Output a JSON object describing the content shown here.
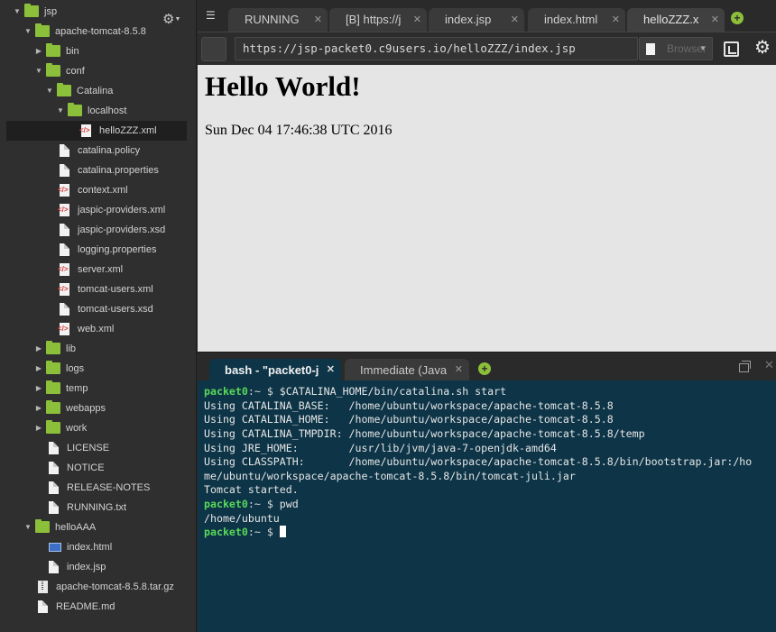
{
  "sidebar": {
    "tree": [
      {
        "label": "jsp",
        "type": "folder",
        "depth": 0,
        "expanded": true
      },
      {
        "label": "apache-tomcat-8.5.8",
        "type": "folder",
        "depth": 1,
        "expanded": true
      },
      {
        "label": "bin",
        "type": "folder",
        "depth": 2,
        "expanded": false
      },
      {
        "label": "conf",
        "type": "folder",
        "depth": 2,
        "expanded": true
      },
      {
        "label": "Catalina",
        "type": "folder",
        "depth": 3,
        "expanded": true
      },
      {
        "label": "localhost",
        "type": "folder",
        "depth": 4,
        "expanded": true
      },
      {
        "label": "helloZZZ.xml",
        "type": "xml",
        "depth": 5,
        "selected": true
      },
      {
        "label": "catalina.policy",
        "type": "file",
        "depth": 3
      },
      {
        "label": "catalina.properties",
        "type": "file",
        "depth": 3
      },
      {
        "label": "context.xml",
        "type": "xml",
        "depth": 3
      },
      {
        "label": "jaspic-providers.xml",
        "type": "xml",
        "depth": 3
      },
      {
        "label": "jaspic-providers.xsd",
        "type": "file",
        "depth": 3
      },
      {
        "label": "logging.properties",
        "type": "file",
        "depth": 3
      },
      {
        "label": "server.xml",
        "type": "xml",
        "depth": 3
      },
      {
        "label": "tomcat-users.xml",
        "type": "xml",
        "depth": 3
      },
      {
        "label": "tomcat-users.xsd",
        "type": "file",
        "depth": 3
      },
      {
        "label": "web.xml",
        "type": "xml",
        "depth": 3
      },
      {
        "label": "lib",
        "type": "folder",
        "depth": 2,
        "expanded": false
      },
      {
        "label": "logs",
        "type": "folder",
        "depth": 2,
        "expanded": false
      },
      {
        "label": "temp",
        "type": "folder",
        "depth": 2,
        "expanded": false
      },
      {
        "label": "webapps",
        "type": "folder",
        "depth": 2,
        "expanded": false
      },
      {
        "label": "work",
        "type": "folder",
        "depth": 2,
        "expanded": false
      },
      {
        "label": "LICENSE",
        "type": "file",
        "depth": 2
      },
      {
        "label": "NOTICE",
        "type": "file",
        "depth": 2
      },
      {
        "label": "RELEASE-NOTES",
        "type": "file",
        "depth": 2
      },
      {
        "label": "RUNNING.txt",
        "type": "file",
        "depth": 2
      },
      {
        "label": "helloAAA",
        "type": "folder",
        "depth": 1,
        "expanded": true
      },
      {
        "label": "index.html",
        "type": "html",
        "depth": 2
      },
      {
        "label": "index.jsp",
        "type": "file",
        "depth": 2
      },
      {
        "label": "apache-tomcat-8.5.8.tar.gz",
        "type": "archive",
        "depth": 1
      },
      {
        "label": "README.md",
        "type": "file",
        "depth": 1
      }
    ]
  },
  "tabs": [
    {
      "label": "RUNNING",
      "closable": true
    },
    {
      "label": "[B] https://j",
      "closable": true
    },
    {
      "label": "index.jsp",
      "closable": true
    },
    {
      "label": "index.html",
      "closable": true
    },
    {
      "label": "helloZZZ.x",
      "closable": true,
      "active": true
    }
  ],
  "urlbar": {
    "url": "https://jsp-packet0.c9users.io/helloZZZ/index.jsp",
    "browser_label": "Browser"
  },
  "preview": {
    "heading": "Hello World!",
    "date": "Sun Dec 04 17:46:38 UTC 2016"
  },
  "terminal": {
    "tabs": [
      {
        "label": "bash - \"packet0-j"
      },
      {
        "label": "Immediate (Java"
      }
    ],
    "prompt_user": "packet0",
    "prompt_path": ":~ $ ",
    "lines": [
      {
        "prompt": true,
        "text": "$CATALINA_HOME/bin/catalina.sh start"
      },
      {
        "text": "Using CATALINA_BASE:   /home/ubuntu/workspace/apache-tomcat-8.5.8"
      },
      {
        "text": "Using CATALINA_HOME:   /home/ubuntu/workspace/apache-tomcat-8.5.8"
      },
      {
        "text": "Using CATALINA_TMPDIR: /home/ubuntu/workspace/apache-tomcat-8.5.8/temp"
      },
      {
        "text": "Using JRE_HOME:        /usr/lib/jvm/java-7-openjdk-amd64"
      },
      {
        "text": "Using CLASSPATH:       /home/ubuntu/workspace/apache-tomcat-8.5.8/bin/bootstrap.jar:/ho"
      },
      {
        "text": "me/ubuntu/workspace/apache-tomcat-8.5.8/bin/tomcat-juli.jar"
      },
      {
        "text": "Tomcat started."
      },
      {
        "prompt": true,
        "text": "pwd"
      },
      {
        "text": "/home/ubuntu"
      },
      {
        "prompt": true,
        "text": "",
        "cursor": true
      }
    ]
  }
}
